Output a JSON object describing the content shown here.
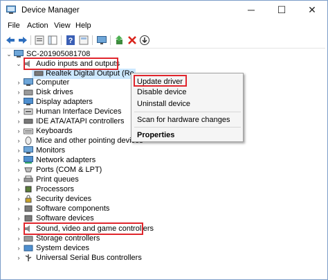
{
  "window": {
    "title": "Device Manager",
    "controls": {
      "minimize": "─",
      "maximize": "☐",
      "close": "✕"
    }
  },
  "menu": [
    "File",
    "Action",
    "View",
    "Help"
  ],
  "toolbar": {
    "icons": [
      "back-arrow-icon",
      "forward-arrow-icon",
      "properties-icon",
      "show-hide-tree-icon",
      "help-icon",
      "properties-sheet-icon",
      "monitor-icon",
      "update-driver-icon",
      "uninstall-icon",
      "download-icon"
    ]
  },
  "tree": {
    "root": "SC-201905081708",
    "expanded_child_label": "Realtek Digital Output (Realtek(R) Audio)",
    "categories": [
      "Audio inputs and outputs",
      "Computer",
      "Disk drives",
      "Display adapters",
      "Human Interface Devices",
      "IDE ATA/ATAPI controllers",
      "Keyboards",
      "Mice and other pointing devices",
      "Monitors",
      "Network adapters",
      "Ports (COM & LPT)",
      "Print queues",
      "Processors",
      "Security devices",
      "Software components",
      "Software devices",
      "Sound, video and game controllers",
      "Storage controllers",
      "System devices",
      "Universal Serial Bus controllers"
    ]
  },
  "context_menu": {
    "items": [
      "Update driver",
      "Disable device",
      "Uninstall device",
      "Scan for hardware changes",
      "Properties"
    ]
  },
  "colors": {
    "highlight_border": "#e0252c",
    "selection": "#cce8ff",
    "accent": "#0078d7"
  }
}
